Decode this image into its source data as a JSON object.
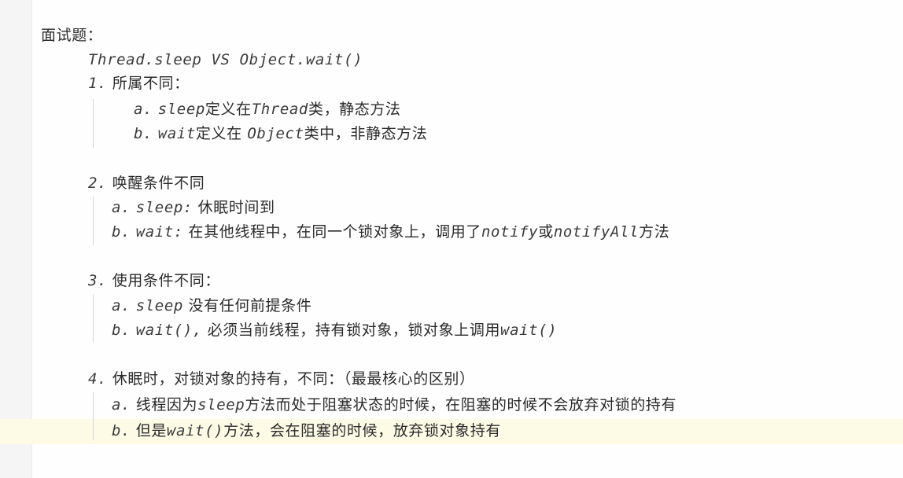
{
  "document": {
    "heading": "面试题：",
    "subtitle": "Thread.sleep VS Object.wait()",
    "sections": [
      {
        "title": {
          "num": "1.",
          "text": "所属不同："
        },
        "items": [
          {
            "letter": "a.",
            "mono1": "sleep",
            "text1": "定义在",
            "mono2": "Thread",
            "text2": "类，静态方法"
          },
          {
            "letter": "b.",
            "mono1": "wait",
            "text1": "定义在 ",
            "mono2": "Object",
            "text2": "类中，非静态方法"
          }
        ]
      },
      {
        "title": {
          "num": "2.",
          "text": "唤醒条件不同"
        },
        "items": [
          {
            "letter": "a.",
            "mono1": "sleep:",
            "text1": " 休眠时间到"
          },
          {
            "letter": "b.",
            "mono1": "wait:",
            "text1": " 在其他线程中，在同一个锁对象上，调用了",
            "mono2": "notify",
            "text2": "或",
            "mono3": "notifyAll",
            "text3": "方法"
          }
        ]
      },
      {
        "title": {
          "num": "3.",
          "text": "使用条件不同："
        },
        "items": [
          {
            "letter": "a.",
            "mono1": "sleep",
            "text1": " 没有任何前提条件"
          },
          {
            "letter": "b.",
            "mono1": "wait(),",
            "text1": " 必须当前线程，持有锁对象，锁对象上调用",
            "mono2": "wait()"
          }
        ]
      },
      {
        "title": {
          "num": "4.",
          "text": "休眠时，对锁对象的持有，不同：（最最核心的区别）"
        },
        "items": [
          {
            "letter": "a.",
            "text1": "线程因为",
            "mono2": "sleep",
            "text2": "方法而处于阻塞状态的时候，在阻塞的时候不会放弃对锁的持有"
          },
          {
            "letter": "b.",
            "text1": "但是",
            "mono2": "wait()",
            "text2": "方法，会在阻塞的时候，放弃锁对象持有"
          }
        ]
      }
    ]
  }
}
